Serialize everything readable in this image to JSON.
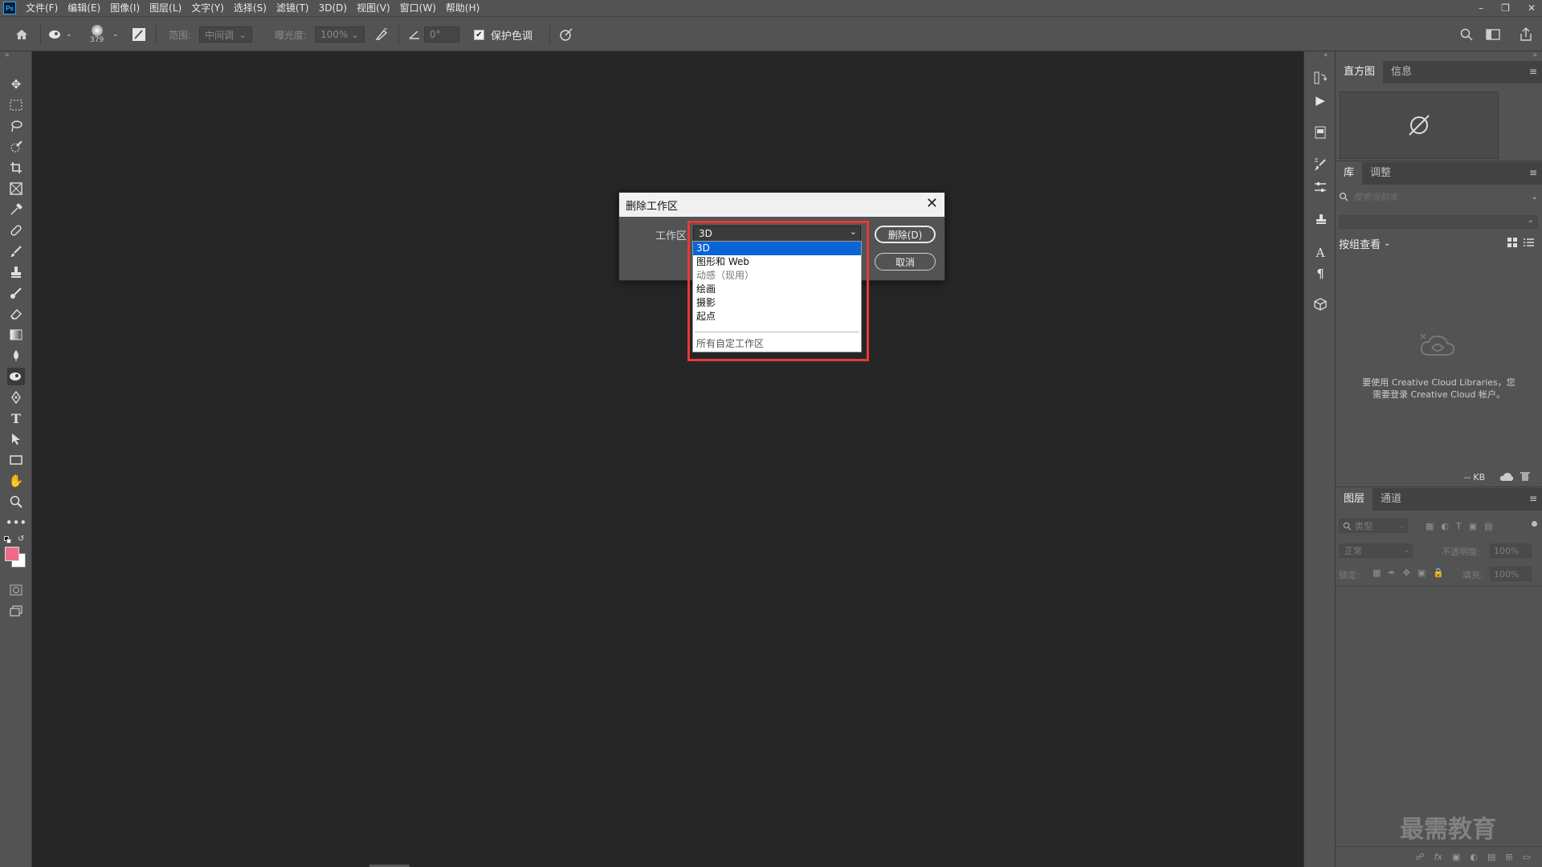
{
  "menubar": {
    "app_icon": "Ps",
    "items": [
      "文件(F)",
      "编辑(E)",
      "图像(I)",
      "图层(L)",
      "文字(Y)",
      "选择(S)",
      "滤镜(T)",
      "3D(D)",
      "视图(V)",
      "窗口(W)",
      "帮助(H)"
    ],
    "window_controls": [
      "minimize-icon",
      "restore-icon",
      "close-icon"
    ]
  },
  "options": {
    "brush_size": "379",
    "range_label": "范围:",
    "range_value": "中间调",
    "exposure_label": "曝光度:",
    "exposure_value": "100%",
    "angle_value": "0°",
    "protect_label": "保护色调",
    "protect_checked": "✔"
  },
  "dialog": {
    "title": "删除工作区",
    "field_label": "工作区:",
    "selected": "3D",
    "delete_label": "删除(D)",
    "cancel_label": "取消",
    "options": [
      {
        "label": "3D",
        "state": "selected"
      },
      {
        "label": "图形和 Web",
        "state": "normal"
      },
      {
        "label": "动感（现用）",
        "state": "disabled"
      },
      {
        "label": "绘画",
        "state": "normal"
      },
      {
        "label": "摄影",
        "state": "normal"
      },
      {
        "label": "起点",
        "state": "normal"
      }
    ],
    "footer_option": "所有自定工作区",
    "highlight_color": "#e53935"
  },
  "panels": {
    "histogram_tabs": [
      "直方图",
      "信息"
    ],
    "library_tabs": [
      "库",
      "调整"
    ],
    "library_search_placeholder": "搜索当前库",
    "group_view_label": "按组查看",
    "cc_message_line1": "要使用 Creative Cloud Libraries，您",
    "cc_message_line2": "需要登录 Creative Cloud 帐户。",
    "size_label": "-- KB",
    "layers_tabs": [
      "图层",
      "通道"
    ],
    "layer_filter_placeholder": "类型",
    "blend_mode": "正常",
    "opacity_label": "不透明度:",
    "opacity_value": "100%",
    "lock_label": "锁定:",
    "fill_label": "填充:",
    "fill_value": "100%"
  },
  "watermark": "最需教育",
  "colors": {
    "foreground": "#f06a8a",
    "background": "#ffffff",
    "selection": "#0a64d8"
  }
}
